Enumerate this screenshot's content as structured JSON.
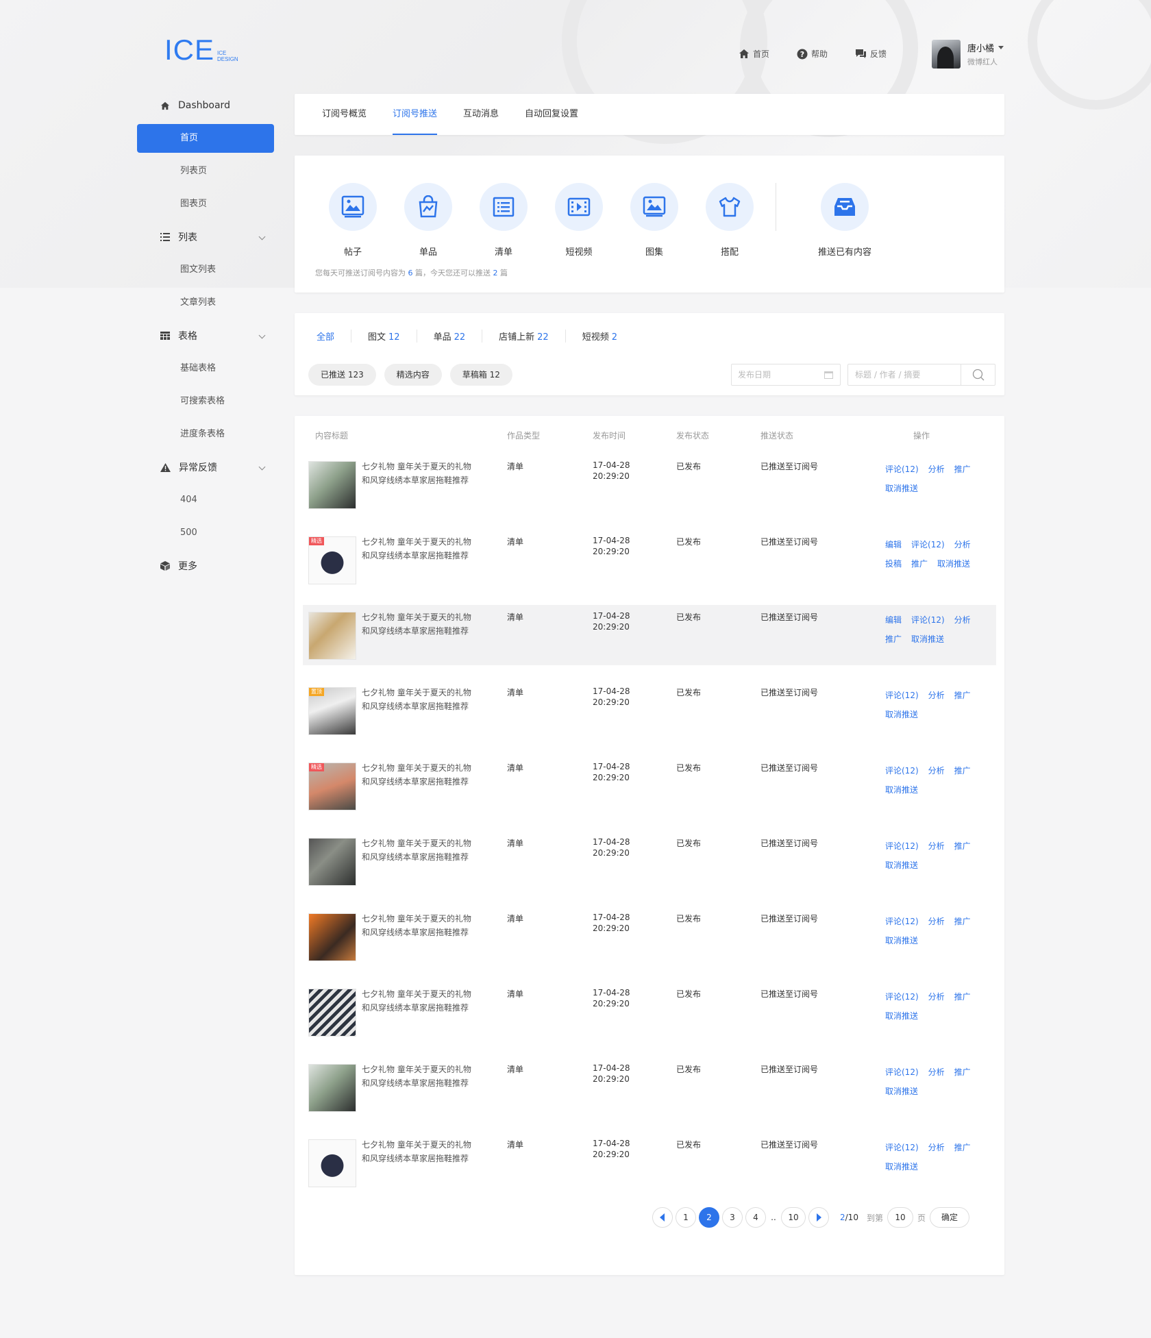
{
  "brand": {
    "logo_main": "ICE",
    "logo_sub_1": "ICE",
    "logo_sub_2": "DESIGN"
  },
  "topnav": [
    {
      "label": "首页",
      "icon": "home-icon"
    },
    {
      "label": "帮助",
      "icon": "help-icon"
    },
    {
      "label": "反馈",
      "icon": "feedback-icon"
    }
  ],
  "user": {
    "name": "唐小橘",
    "role": "微博红人"
  },
  "sidebar": {
    "dashboard": "Dashboard",
    "home": "首页",
    "list_page": "列表页",
    "chart_page": "图表页",
    "list_group": "列表",
    "graphic_list": "图文列表",
    "article_list": "文章列表",
    "table_group": "表格",
    "basic_table": "基础表格",
    "search_table": "可搜索表格",
    "progress_table": "进度条表格",
    "error_group": "异常反馈",
    "e404": "404",
    "e500": "500",
    "more": "更多"
  },
  "tabs": [
    "订阅号概览",
    "订阅号推送",
    "互动消息",
    "自动回复设置"
  ],
  "types": [
    "帖子",
    "单品",
    "清单",
    "短视频",
    "图集",
    "搭配"
  ],
  "push_existing": "推送已有内容",
  "types_note": {
    "p1": "您每天可推送订阅号内容为",
    "n1": "6",
    "p2": "篇，今天您还可以推送",
    "n2": "2",
    "p3": "篇"
  },
  "filter_tabs": [
    {
      "label": "全部",
      "count": ""
    },
    {
      "label": "图文",
      "count": "12"
    },
    {
      "label": "单品",
      "count": "22"
    },
    {
      "label": "店铺上新",
      "count": "22"
    },
    {
      "label": "短视频",
      "count": "2"
    }
  ],
  "pills": [
    "已推送 123",
    "精选内容",
    "草稿箱 12"
  ],
  "date_placeholder": "发布日期",
  "search_placeholder": "标题 / 作者 / 摘要",
  "table": {
    "headers": [
      "内容标题",
      "作品类型",
      "发布时间",
      "发布状态",
      "推送状态",
      "操作"
    ],
    "rows": [
      {
        "title": "七夕礼物 童年关于夏天的礼物和风穿线绣本草家居拖鞋推荐",
        "type": "清单",
        "date": "17-04-28",
        "time": "20:29:20",
        "status": "已发布",
        "push": "已推送至订阅号",
        "badge": "",
        "ops": [
          "评论(12)",
          "分析",
          "推广",
          "取消推送"
        ]
      },
      {
        "title": "七夕礼物 童年关于夏天的礼物和风穿线绣本草家居拖鞋推荐",
        "type": "清单",
        "date": "17-04-28",
        "time": "20:29:20",
        "status": "已发布",
        "push": "已推送至订阅号",
        "badge": "精选",
        "ops": [
          "编辑",
          "评论(12)",
          "分析",
          "投稿",
          "推广",
          "取消推送"
        ]
      },
      {
        "title": "七夕礼物 童年关于夏天的礼物和风穿线绣本草家居拖鞋推荐",
        "type": "清单",
        "date": "17-04-28",
        "time": "20:29:20",
        "status": "已发布",
        "push": "已推送至订阅号",
        "badge": "",
        "ops": [
          "编辑",
          "评论(12)",
          "分析",
          "推广",
          "取消推送"
        ]
      },
      {
        "title": "七夕礼物 童年关于夏天的礼物和风穿线绣本草家居拖鞋推荐",
        "type": "清单",
        "date": "17-04-28",
        "time": "20:29:20",
        "status": "已发布",
        "push": "已推送至订阅号",
        "badge": "置顶",
        "ops": [
          "评论(12)",
          "分析",
          "推广",
          "取消推送"
        ]
      },
      {
        "title": "七夕礼物 童年关于夏天的礼物和风穿线绣本草家居拖鞋推荐",
        "type": "清单",
        "date": "17-04-28",
        "time": "20:29:20",
        "status": "已发布",
        "push": "已推送至订阅号",
        "badge": "精选",
        "ops": [
          "评论(12)",
          "分析",
          "推广",
          "取消推送"
        ]
      },
      {
        "title": "七夕礼物 童年关于夏天的礼物和风穿线绣本草家居拖鞋推荐",
        "type": "清单",
        "date": "17-04-28",
        "time": "20:29:20",
        "status": "已发布",
        "push": "已推送至订阅号",
        "badge": "",
        "ops": [
          "评论(12)",
          "分析",
          "推广",
          "取消推送"
        ]
      },
      {
        "title": "七夕礼物 童年关于夏天的礼物和风穿线绣本草家居拖鞋推荐",
        "type": "清单",
        "date": "17-04-28",
        "time": "20:29:20",
        "status": "已发布",
        "push": "已推送至订阅号",
        "badge": "",
        "ops": [
          "评论(12)",
          "分析",
          "推广",
          "取消推送"
        ]
      },
      {
        "title": "七夕礼物 童年关于夏天的礼物和风穿线绣本草家居拖鞋推荐",
        "type": "清单",
        "date": "17-04-28",
        "time": "20:29:20",
        "status": "已发布",
        "push": "已推送至订阅号",
        "badge": "",
        "ops": [
          "评论(12)",
          "分析",
          "推广",
          "取消推送"
        ]
      },
      {
        "title": "七夕礼物 童年关于夏天的礼物和风穿线绣本草家居拖鞋推荐",
        "type": "清单",
        "date": "17-04-28",
        "time": "20:29:20",
        "status": "已发布",
        "push": "已推送至订阅号",
        "badge": "",
        "ops": [
          "评论(12)",
          "分析",
          "推广",
          "取消推送"
        ]
      },
      {
        "title": "七夕礼物 童年关于夏天的礼物和风穿线绣本草家居拖鞋推荐",
        "type": "清单",
        "date": "17-04-28",
        "time": "20:29:20",
        "status": "已发布",
        "push": "已推送至订阅号",
        "badge": "",
        "ops": [
          "评论(12)",
          "分析",
          "推广",
          "取消推送"
        ]
      }
    ]
  },
  "pagination": {
    "pages": [
      "1",
      "2",
      "3",
      "4"
    ],
    "dots": "..",
    "last": "10",
    "current": "2",
    "total": "/10",
    "goto_label": "到第",
    "goto_value": "10",
    "page_unit": "页",
    "confirm": "确定"
  },
  "colors": {
    "accent": "#2d74ea",
    "badge_featured": "#f0575a",
    "badge_top": "#f5a623"
  }
}
